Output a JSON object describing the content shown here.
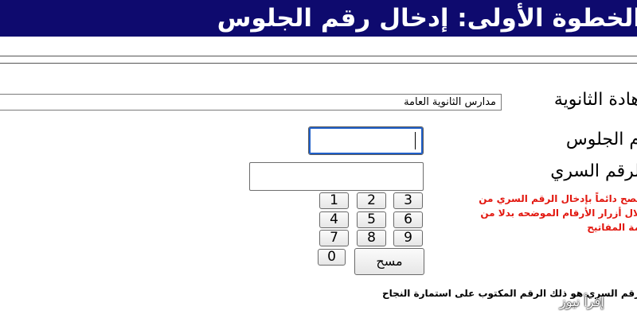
{
  "header": {
    "title": "الخطوة الأولى: إدخال رقم الجلوس"
  },
  "form": {
    "certificate_label": "هادة الثانوية",
    "certificate_value": "مدارس الثانوية العامة",
    "seat_label": "م الجلوس",
    "seat_value": "",
    "secret_label": "لرقم السري",
    "secret_value": ""
  },
  "keypad": {
    "keys": [
      "1",
      "2",
      "3",
      "4",
      "5",
      "6",
      "7",
      "8",
      "9",
      "0"
    ],
    "clear_label": "مسح"
  },
  "note": {
    "line1": "نصح دائماً بإدخال الرقم السري من",
    "line2": "لال أزرار الأرقام الموضحه بدلا من",
    "line3": "مة المفاتيح"
  },
  "footer": {
    "text": "رقم السري هو ذلك الرقم المكتوب على استمارة النجاح"
  },
  "watermark": {
    "text": "إقرأ نيوز"
  },
  "colors": {
    "header_bg": "#0e0a6e",
    "note_text": "#e2170f",
    "focus": "#1f5fc9"
  }
}
